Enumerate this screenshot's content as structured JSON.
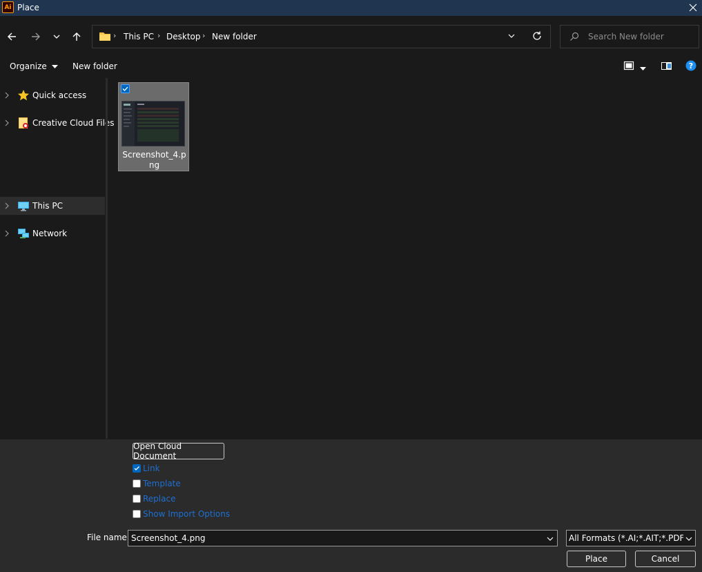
{
  "window": {
    "app_icon_text": "Ai",
    "title": "Place"
  },
  "address": {
    "crumbs": [
      "This PC",
      "Desktop",
      "New folder"
    ]
  },
  "search": {
    "placeholder": "Search New folder"
  },
  "toolbar": {
    "organize_label": "Organize",
    "new_folder_label": "New folder"
  },
  "sidebar": {
    "items": [
      {
        "label": "Quick access",
        "icon": "star-icon"
      },
      {
        "label": "Creative Cloud Files",
        "icon": "creative-cloud-folder-icon"
      },
      {
        "label": "This PC",
        "icon": "computer-icon",
        "selected": true
      },
      {
        "label": "Network",
        "icon": "network-icon"
      }
    ]
  },
  "files": [
    {
      "name": "Screenshot_4.png",
      "selected": true
    }
  ],
  "options": {
    "open_cloud_label": "Open Cloud Document",
    "checkboxes": [
      {
        "label": "Link",
        "checked": true
      },
      {
        "label": "Template",
        "checked": false
      },
      {
        "label": "Replace",
        "checked": false
      },
      {
        "label": "Show Import Options",
        "checked": false
      }
    ]
  },
  "footer": {
    "file_name_label": "File name:",
    "file_name_value": "Screenshot_4.png",
    "format_value": "All Formats (*.AI;*.AIT;*.PDF;*.D",
    "place_label": "Place",
    "cancel_label": "Cancel"
  },
  "colors": {
    "titlebar": "#1f3550",
    "accent": "#0067c0",
    "link_text": "#1f6fd1"
  }
}
